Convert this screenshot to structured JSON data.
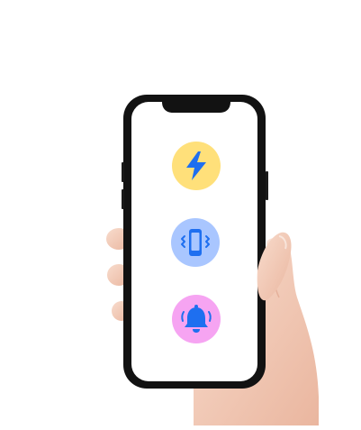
{
  "scene": {
    "description_free": true
  },
  "features": [
    {
      "name": "power",
      "icon": "lightning-bolt-icon",
      "bg_color": "#ffe07a",
      "fg_color": "#1e6ff0"
    },
    {
      "name": "vibrate",
      "icon": "vibrating-phone-icon",
      "bg_color": "#a9c6ff",
      "fg_color": "#1e6ff0"
    },
    {
      "name": "alert",
      "icon": "ringing-bell-icon",
      "bg_color": "#f6a4f2",
      "fg_color": "#1e6ff0"
    }
  ],
  "colors": {
    "phone_frame": "#121212",
    "screen": "#ffffff",
    "skin": "#f4cdb9",
    "skin_shadow": "#e3b09a"
  }
}
